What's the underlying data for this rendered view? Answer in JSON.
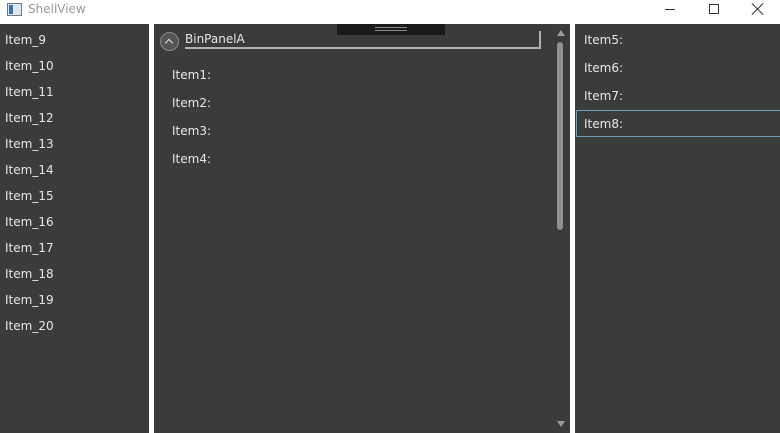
{
  "window": {
    "title": "ShellView"
  },
  "left_list": {
    "items": [
      "Item_9",
      "Item_10",
      "Item_11",
      "Item_12",
      "Item_13",
      "Item_14",
      "Item_15",
      "Item_16",
      "Item_17",
      "Item_18",
      "Item_19",
      "Item_20"
    ]
  },
  "bin_panel": {
    "title": "BinPanelA",
    "expanded": true,
    "items": [
      "Item1:",
      "Item2:",
      "Item3:",
      "Item4:"
    ]
  },
  "right_list": {
    "items": [
      "Item5:",
      "Item6:",
      "Item7:",
      "Item8:"
    ],
    "focused_item": "Item8:"
  },
  "colors": {
    "pane_background": "#3b3b3b",
    "text": "#e6e6e6",
    "focus_border": "#6f9fc0"
  }
}
